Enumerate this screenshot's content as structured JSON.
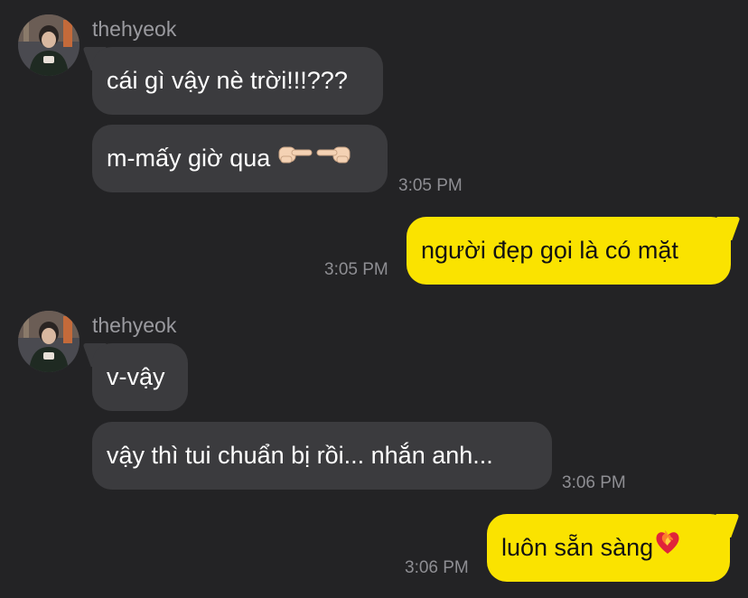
{
  "conversation": {
    "groups": [
      {
        "sender": "thehyeok",
        "avatar_icon": "user-avatar",
        "messages": [
          {
            "text": "cái gì vậy nè trời!!!???"
          },
          {
            "text": "m-mấy giờ qua ",
            "emoji": "pointing-fingers-emoji",
            "time": "3:05 PM"
          }
        ]
      },
      {
        "outgoing": true,
        "messages": [
          {
            "text": "người đẹp gọi là có mặt",
            "time": "3:05 PM"
          }
        ]
      },
      {
        "sender": "thehyeok",
        "avatar_icon": "user-avatar",
        "messages": [
          {
            "text": "v-vậy"
          },
          {
            "text": "vậy thì tui chuẩn bị rồi... nhắn anh...",
            "time": "3:06 PM"
          }
        ]
      },
      {
        "outgoing": true,
        "messages": [
          {
            "text": "luôn sẵn sàng",
            "emoji": "heart-on-fire-emoji",
            "time": "3:06 PM"
          }
        ]
      }
    ]
  },
  "colors": {
    "background": "#232325",
    "incoming_bubble": "#3b3b3e",
    "outgoing_bubble": "#fae300",
    "timestamp": "#8e8e93",
    "sender_name": "#9a9a9f"
  }
}
